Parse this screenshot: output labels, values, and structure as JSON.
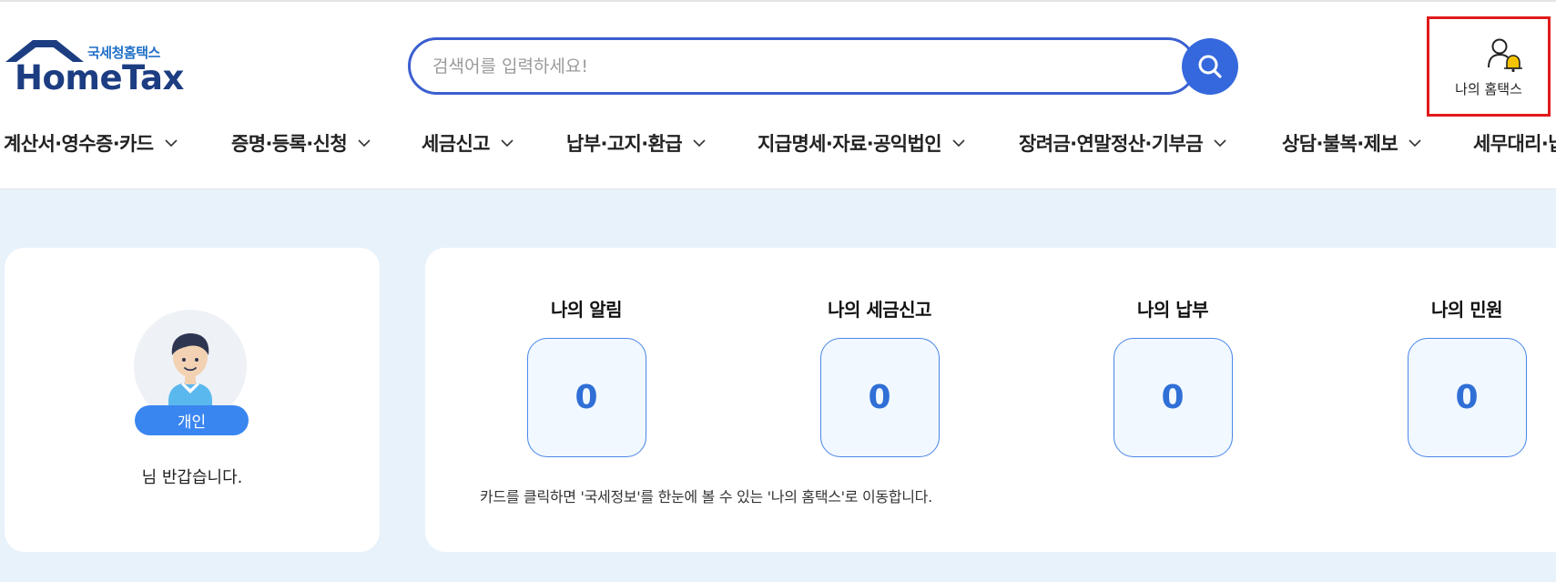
{
  "logo": {
    "sub": "국세청홈택스",
    "main": "HomeTax"
  },
  "search": {
    "placeholder": "검색어를 입력하세요!"
  },
  "my_hometax": {
    "label": "나의 홈택스"
  },
  "nav": [
    {
      "label": "계산서·영수증·카드"
    },
    {
      "label": "증명·등록·신청"
    },
    {
      "label": "세금신고"
    },
    {
      "label": "납부·고지·환급"
    },
    {
      "label": "지급명세·자료·공익법인"
    },
    {
      "label": "장려금·연말정산·기부금"
    },
    {
      "label": "상담·불복·제보"
    },
    {
      "label": "세무대리·납"
    }
  ],
  "profile": {
    "badge": "개인",
    "greeting": "님 반갑습니다."
  },
  "summary": {
    "items": [
      {
        "title": "나의 알림",
        "count": "0"
      },
      {
        "title": "나의 세금신고",
        "count": "0"
      },
      {
        "title": "나의 납부",
        "count": "0"
      },
      {
        "title": "나의 민원",
        "count": "0"
      }
    ],
    "note": "카드를 클릭하면 '국세정보'를 한눈에 볼 수 있는 '나의 홈택스'로 이동합니다."
  },
  "colors": {
    "brand": "#1c3d82",
    "accent": "#3568dd",
    "highlight_border": "#e01a1a",
    "background": "#e8f2fb"
  },
  "icons": {
    "search": "search-icon",
    "my_hometax": "user-bell-icon",
    "chevron": "chevron-down-icon",
    "logo": "house-roof-icon"
  }
}
